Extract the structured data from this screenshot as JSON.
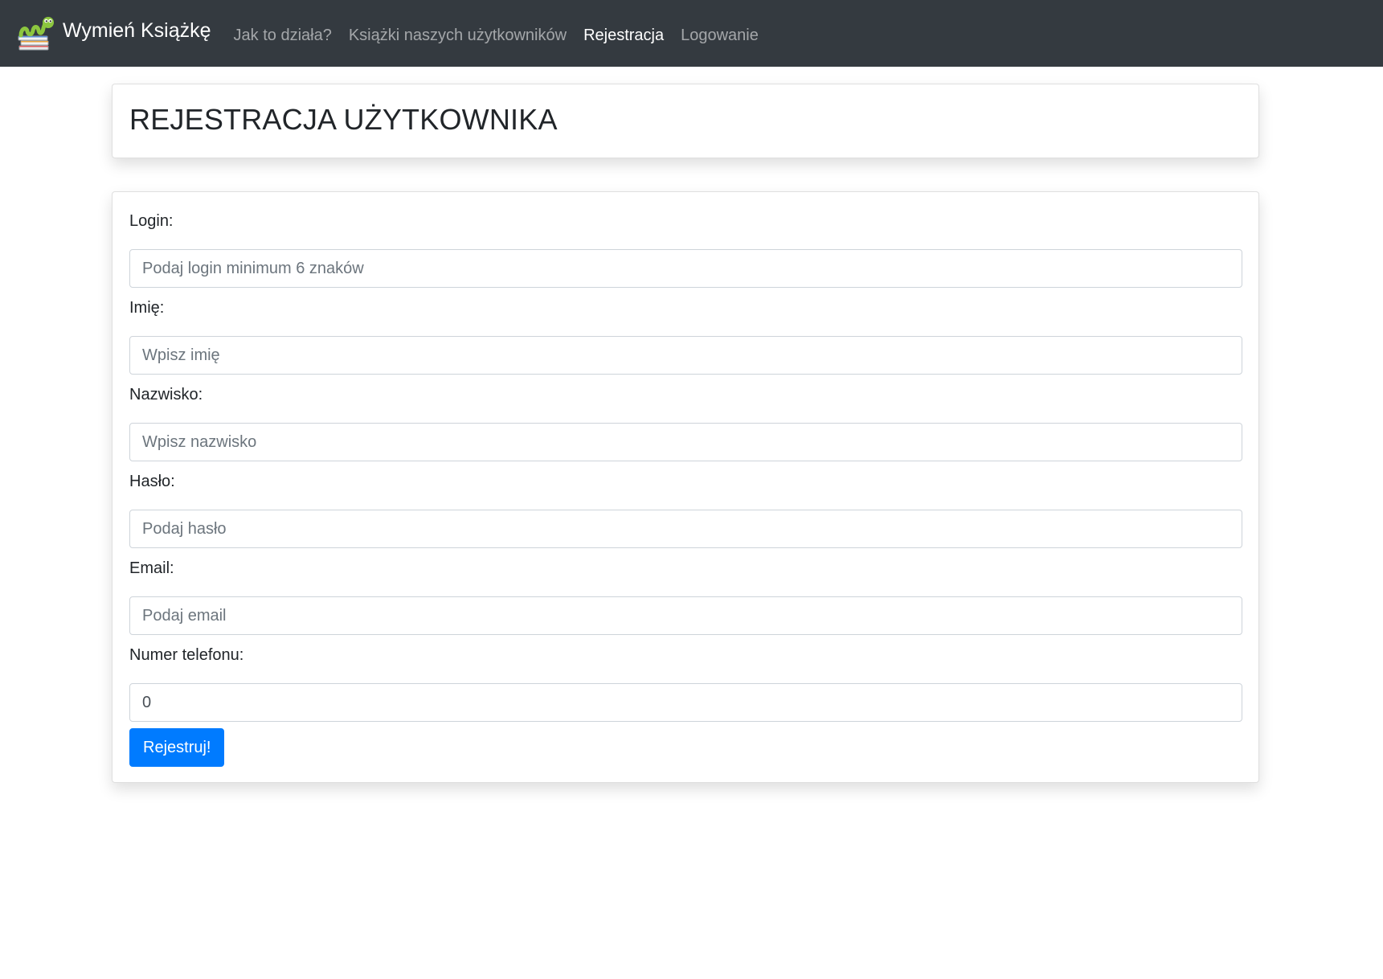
{
  "navbar": {
    "brand": {
      "logo_icon": "bookworm-on-books-icon",
      "text": "Wymień Książkę"
    },
    "links": [
      {
        "label": "Jak to działa?",
        "active": false
      },
      {
        "label": "Książki naszych użytkowników",
        "active": false
      },
      {
        "label": "Rejestracja",
        "active": true
      },
      {
        "label": "Logowanie",
        "active": false
      }
    ],
    "background_color": "#343a40"
  },
  "header": {
    "title": "REJESTRACJA UŻYTKOWNIKA"
  },
  "form": {
    "fields": [
      {
        "label": "Login:",
        "placeholder": "Podaj login minimum 6 znaków",
        "value": ""
      },
      {
        "label": "Imię:",
        "placeholder": "Wpisz imię",
        "value": ""
      },
      {
        "label": "Nazwisko:",
        "placeholder": "Wpisz nazwisko",
        "value": ""
      },
      {
        "label": "Hasło:",
        "placeholder": "Podaj hasło",
        "value": ""
      },
      {
        "label": "Email:",
        "placeholder": "Podaj email",
        "value": ""
      },
      {
        "label": "Numer telefonu:",
        "placeholder": "",
        "value": "0"
      }
    ],
    "submit_label": "Rejestruj!",
    "submit_color": "#007bff"
  }
}
